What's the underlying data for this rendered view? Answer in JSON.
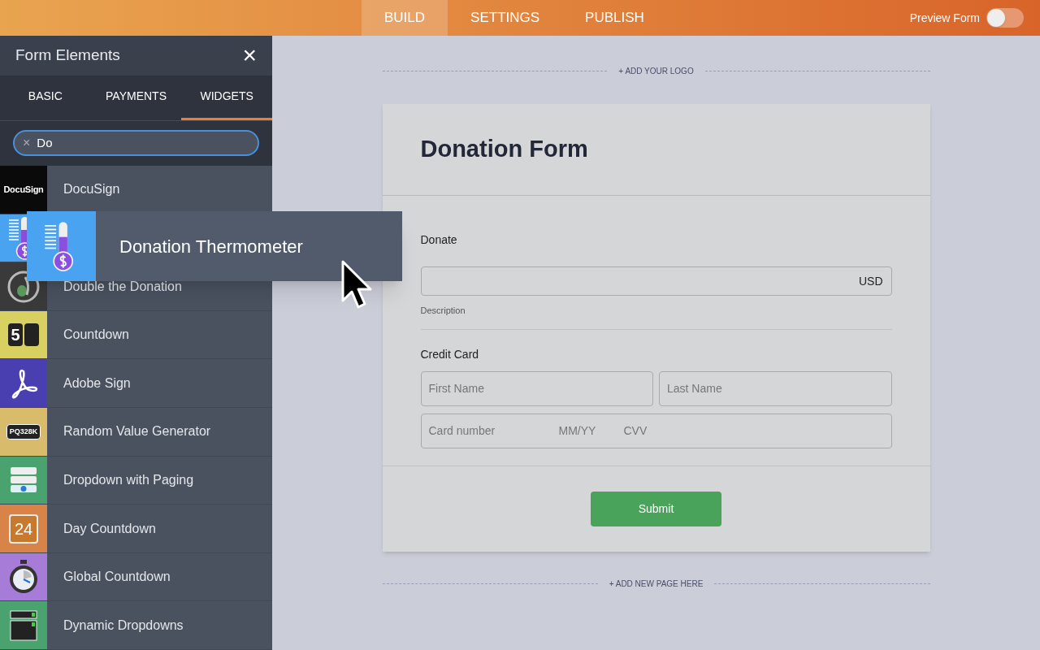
{
  "top_tabs": [
    {
      "label": "BUILD",
      "selected": true
    },
    {
      "label": "SETTINGS",
      "selected": false
    },
    {
      "label": "PUBLISH",
      "selected": false
    }
  ],
  "preview": {
    "label": "Preview Form",
    "on": false
  },
  "sidebar": {
    "title": "Form Elements",
    "close": "×",
    "tabs": [
      {
        "label": "BASIC",
        "selected": false
      },
      {
        "label": "PAYMENTS",
        "selected": false
      },
      {
        "label": "WIDGETS",
        "selected": true
      }
    ],
    "search": {
      "value": "Do",
      "clear": "×"
    },
    "items": [
      {
        "kind": "docusign",
        "label": "DocuSign",
        "icon_text": "DocuSign",
        "color": "#0a0a0a"
      },
      {
        "kind": "thermometer",
        "color": "#4aa3f0"
      },
      {
        "kind": "double",
        "label": "Double the Donation",
        "color": "#3a3a3a"
      },
      {
        "kind": "countdown",
        "label": "Countdown",
        "icon_text": "5",
        "color": "#d8d060"
      },
      {
        "kind": "adobe",
        "label": "Adobe Sign",
        "color": "#4a3fb0"
      },
      {
        "kind": "random",
        "label": "Random Value Generator",
        "icon_text": "PQ328K",
        "color": "#d8bc6c"
      },
      {
        "kind": "paging",
        "label": "Dropdown with Paging",
        "color": "#4aa36e"
      },
      {
        "kind": "day",
        "label": "Day Countdown",
        "icon_text": "24",
        "color": "#d88448"
      },
      {
        "kind": "stopwatch",
        "label": "Global Countdown",
        "color": "#a77cd8"
      },
      {
        "kind": "dropdowns",
        "label": "Dynamic Dropdowns",
        "color": "#4aa36e"
      }
    ]
  },
  "dragged": {
    "label": "Donation Thermometer"
  },
  "canvas": {
    "add_logo": "+ ADD YOUR LOGO",
    "add_page": "+ ADD NEW PAGE HERE"
  },
  "form": {
    "title": "Donation Form",
    "donate": {
      "label": "Donate",
      "currency": "USD",
      "sublabel": "Description"
    },
    "card": {
      "label": "Credit Card",
      "first_placeholder": "First Name",
      "last_placeholder": "Last Name",
      "number": "Card number",
      "expiry": "MM/YY",
      "cvv": "CVV"
    },
    "submit": "Submit"
  }
}
